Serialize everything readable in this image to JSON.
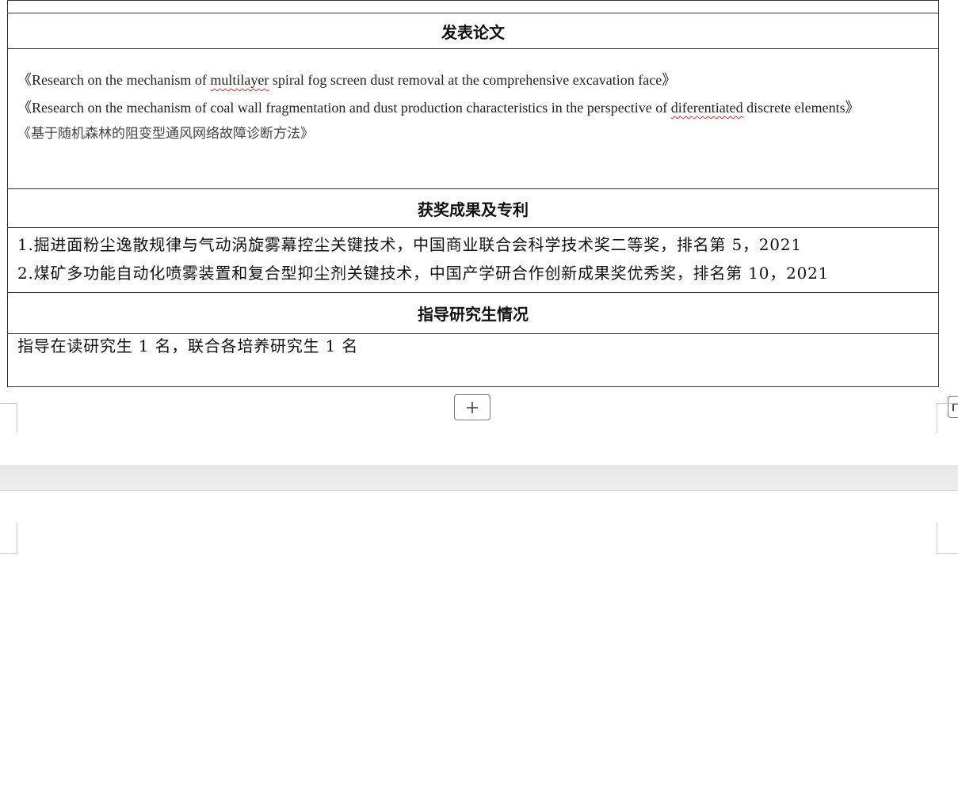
{
  "papers": {
    "heading": "发表论文",
    "line1_pre": "《Research on the mechanism of ",
    "line1_flag": "multilayer",
    "line1_post": " spiral fog screen dust removal at the comprehensive excavation face》",
    "line2_pre": "《Research on the mechanism of coal wall fragmentation and dust production characteristics in the perspective of ",
    "line2_flag": "diferentiated",
    "line2_post": " discrete elements》",
    "line3": "《基于随机森林的阻变型通风网络故障诊断方法》"
  },
  "awards": {
    "heading": "获奖成果及专利",
    "items": [
      "1.掘进面粉尘逸散规律与气动涡旋雾幕控尘关键技术，中国商业联合会科学技术奖二等奖，排名第 5，2021",
      "2.煤矿多功能自动化喷雾装置和复合型抑尘剂关键技术，中国产学研合作创新成果奖优秀奖，排名第 10，2021"
    ]
  },
  "students": {
    "heading": "指导研究生情况",
    "text": "指导在读研究生 1 名，联合各培养研究生 1 名"
  },
  "controls": {
    "add_row_icon": "plus-icon",
    "table_handle_icon": "table-handle-icon"
  }
}
